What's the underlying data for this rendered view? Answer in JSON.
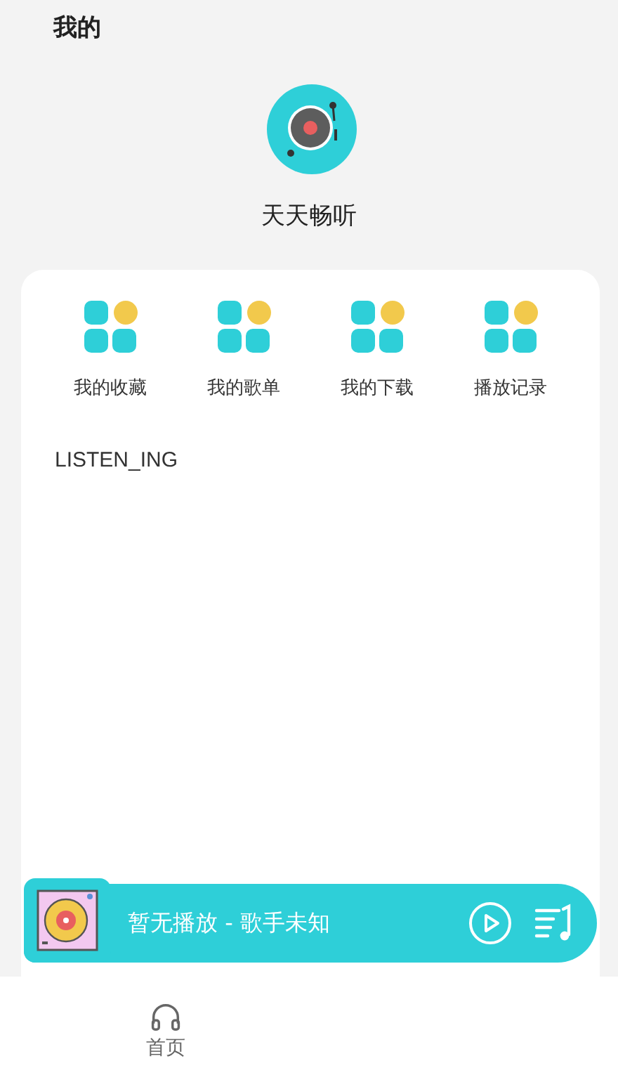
{
  "header": {
    "title": "我的"
  },
  "profile": {
    "app_name": "天天畅听"
  },
  "shortcuts": [
    {
      "label": "我的收藏"
    },
    {
      "label": "我的歌单"
    },
    {
      "label": "我的下载"
    },
    {
      "label": "播放记录"
    }
  ],
  "section": {
    "title": "LISTEN_ING"
  },
  "player": {
    "track": "暂无播放 - 歌手未知",
    "playing": false
  },
  "bottom_nav": [
    {
      "label": "首页",
      "selected": false
    }
  ]
}
